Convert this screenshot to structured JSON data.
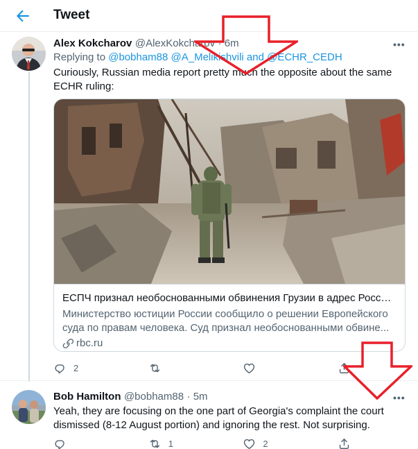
{
  "header": {
    "title": "Tweet"
  },
  "tweet1": {
    "name": "Alex Kokcharov",
    "handle": "@AlexKokcharov",
    "time": "· 6m",
    "replying_prefix": "Replying to",
    "replying_to": "@bobham88 @A_Melikishvili and @ECHR_CEDH",
    "text_line1": "Curiously, Russian media report pretty much the opposite about the same",
    "text_line2": "ECHR ruling:",
    "card": {
      "title": "ЕСПЧ признал необоснованными обвинения Грузии в адрес России...",
      "desc_line1": "Министерство юстиции России сообщило о решении Европейского",
      "desc_line2": "суда по правам человека. Суд признал необоснованными обвине...",
      "domain": "rbc.ru"
    },
    "reply_count": "2",
    "retweet_count": "",
    "like_count": ""
  },
  "tweet2": {
    "name": "Bob Hamilton",
    "handle": "@bobham88",
    "time": "· 5m",
    "text_line1": "Yeah, they are focusing on the one part of Georgia's complaint the court",
    "text_line2": "dismissed (8-12 August portion) and ignoring the rest.  Not surprising.",
    "reply_count": "",
    "retweet_count": "1",
    "like_count": "2"
  },
  "colors": {
    "accent": "#1b95e0",
    "arrow": "#e8202a",
    "muted": "#536471"
  },
  "icons": [
    "back-arrow-icon",
    "more-icon",
    "reply-icon",
    "retweet-icon",
    "like-icon",
    "share-icon",
    "link-icon"
  ]
}
